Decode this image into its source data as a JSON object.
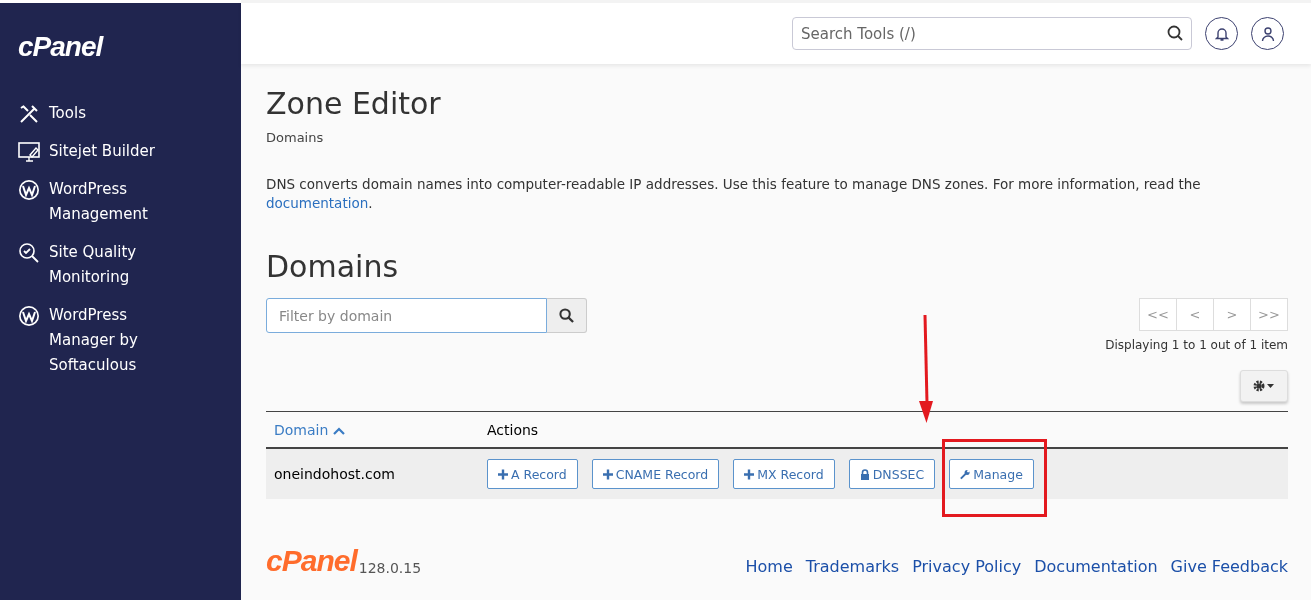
{
  "sidebar": {
    "logo": "cPanel",
    "items": [
      {
        "kind": "tools",
        "label": "Tools"
      },
      {
        "kind": "monitor",
        "label": "Sitejet Builder"
      },
      {
        "kind": "wordpress",
        "label": "WordPress Management"
      },
      {
        "kind": "magnifier",
        "label": "Site Quality Monitoring"
      },
      {
        "kind": "wordpress",
        "label": "WordPress Manager by Softaculous"
      }
    ]
  },
  "header": {
    "search": {
      "placeholder": "Search Tools (/)"
    }
  },
  "page": {
    "title": "Zone Editor",
    "breadcrumb": "Domains",
    "description": "DNS converts domain names into computer-readable IP addresses. Use this feature to manage DNS zones. For more information, read the",
    "description_link": "documentation",
    "description_end": ".",
    "section_title": "Domains"
  },
  "filter": {
    "placeholder": "Filter by domain"
  },
  "pagination": {
    "buttons": [
      "<<",
      "<",
      ">",
      ">>"
    ],
    "summary": "Displaying 1 to 1 out of 1 item"
  },
  "table": {
    "columns": [
      {
        "label": "Domain",
        "sorted": true
      },
      {
        "label": "Actions",
        "sorted": false
      }
    ],
    "rows": [
      {
        "domain": "oneindohost.com",
        "actions": [
          {
            "kind": "plus",
            "label": "A Record"
          },
          {
            "kind": "plus",
            "label": "CNAME Record"
          },
          {
            "kind": "plus",
            "label": "MX Record"
          },
          {
            "kind": "lock",
            "label": "DNSSEC"
          },
          {
            "kind": "wrench",
            "label": "Manage",
            "highlighted": true
          }
        ]
      }
    ]
  },
  "footer": {
    "logo": "cPanel",
    "version": "128.0.15",
    "links": [
      "Home",
      "Trademarks",
      "Privacy Policy",
      "Documentation",
      "Give Feedback"
    ]
  }
}
